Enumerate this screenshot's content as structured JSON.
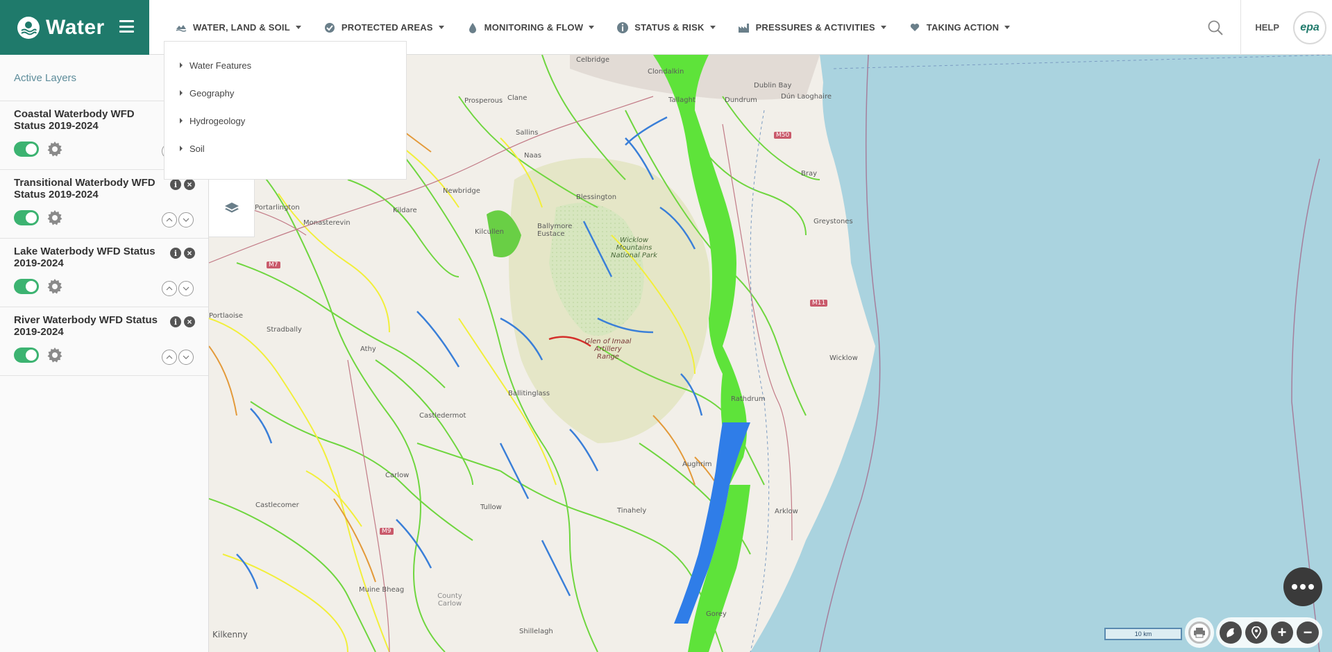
{
  "app": {
    "title": "Water"
  },
  "nav": {
    "items": [
      {
        "label": "WATER, LAND & SOIL",
        "icon": "land-icon"
      },
      {
        "label": "PROTECTED AREAS",
        "icon": "protected-areas-icon"
      },
      {
        "label": "MONITORING & FLOW",
        "icon": "water-drop-icon"
      },
      {
        "label": "STATUS & RISK",
        "icon": "info-icon"
      },
      {
        "label": "PRESSURES & ACTIVITIES",
        "icon": "factory-icon"
      },
      {
        "label": "TAKING ACTION",
        "icon": "heart-icon"
      }
    ],
    "help": "HELP",
    "logo_text": "epa"
  },
  "dropdown": {
    "items": [
      "Water Features",
      "Geography",
      "Hydrogeology",
      "Soil"
    ]
  },
  "sidebar": {
    "title": "Active Layers",
    "layers": [
      {
        "name": "Coastal Waterbody WFD Status 2019-2024",
        "enabled": true
      },
      {
        "name": "Transitional Waterbody WFD Status 2019-2024",
        "enabled": true
      },
      {
        "name": "Lake Waterbody WFD Status 2019-2024",
        "enabled": true
      },
      {
        "name": "River Waterbody WFD Status 2019-2024",
        "enabled": true
      }
    ],
    "info_glyph": "i",
    "close_glyph": "×"
  },
  "map": {
    "places": [
      "Celbridge",
      "Clondalkin",
      "Dublin Bay",
      "Dún Laoghaire",
      "Tallaght",
      "Dundrum",
      "Prosperous",
      "Clane",
      "Sallins",
      "Naas",
      "Bray",
      "Newbridge",
      "Kildare",
      "Blessington",
      "Monasterevin",
      "Kilcullen",
      "Ballymore Eustace",
      "Wicklow Mountains National Park",
      "Greystones",
      "Stradbally",
      "Athy",
      "Glen of Imaal Artillery Range",
      "Wicklow",
      "Ballitinglass",
      "Rathdrum",
      "Castledermot",
      "Aughrim",
      "Carlow",
      "Tullow",
      "Castlecomer",
      "Tinahely",
      "Arklow",
      "Muine Bheag",
      "County Carlow",
      "Gorey",
      "Kilkenny",
      "Shillelagh",
      "Portarlington",
      "Portlaoise"
    ],
    "roads": [
      "M50",
      "M11",
      "M7",
      "M9"
    ],
    "scale_label": "10 km"
  },
  "controls": {
    "more_label": "•••",
    "zoom_in": "+",
    "zoom_out": "−"
  },
  "colors": {
    "brand": "#1f7a6b",
    "toggle_on": "#3cb371",
    "sea": "#aad3df",
    "coastal_good": "#5ee33a",
    "coastal_moderate": "#2f7de8",
    "river_good": "#6fd63f",
    "river_high": "#3a7fd8",
    "river_moderate": "#f2ef3a",
    "river_poor": "#e39a3a",
    "river_bad": "#d4302b"
  }
}
